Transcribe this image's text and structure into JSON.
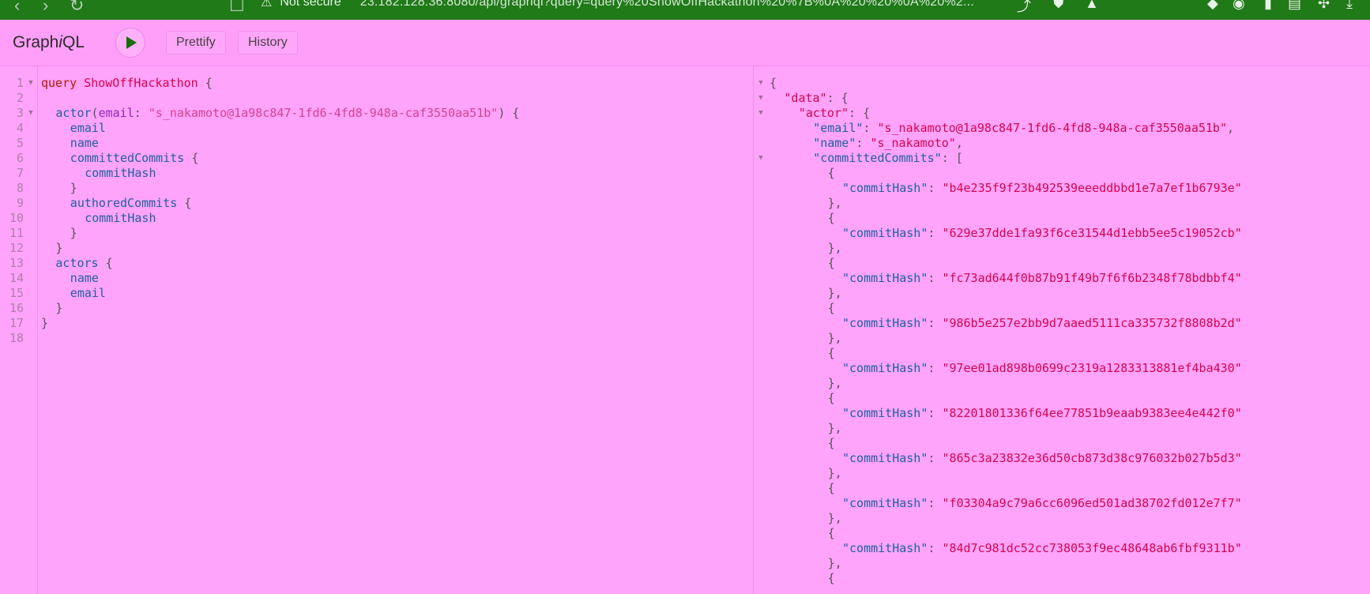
{
  "browser": {
    "security_label": "Not secure",
    "url": "23.182.128.36:8080/api/graphql?query=query%20ShowOffHackathon%20%7B%0A%20%20%0A%20%2..."
  },
  "toolbar": {
    "logo_part1": "Graph",
    "logo_part2": "i",
    "logo_part3": "QL",
    "prettify_label": "Prettify",
    "history_label": "History"
  },
  "query_lines": [
    {
      "n": "1",
      "fold": true,
      "indent": 0,
      "tokens": [
        [
          "kw",
          "query "
        ],
        [
          "def",
          "ShowOffHackathon"
        ],
        [
          "pun",
          " {"
        ]
      ]
    },
    {
      "n": "2",
      "fold": false,
      "indent": 0,
      "tokens": []
    },
    {
      "n": "3",
      "fold": true,
      "indent": 1,
      "tokens": [
        [
          "prop",
          "actor"
        ],
        [
          "pun",
          "("
        ],
        [
          "attr",
          "email"
        ],
        [
          "pun",
          ": "
        ],
        [
          "str",
          "\"s_nakamoto@1a98c847-1fd6-4fd8-948a-caf3550aa51b\""
        ],
        [
          "pun",
          ") {"
        ]
      ]
    },
    {
      "n": "4",
      "fold": false,
      "indent": 2,
      "tokens": [
        [
          "prop",
          "email"
        ]
      ]
    },
    {
      "n": "5",
      "fold": false,
      "indent": 2,
      "tokens": [
        [
          "prop",
          "name"
        ]
      ]
    },
    {
      "n": "6",
      "fold": false,
      "indent": 2,
      "tokens": [
        [
          "prop",
          "committedCommits"
        ],
        [
          "pun",
          " {"
        ]
      ]
    },
    {
      "n": "7",
      "fold": false,
      "indent": 3,
      "tokens": [
        [
          "prop",
          "commitHash"
        ]
      ]
    },
    {
      "n": "8",
      "fold": false,
      "indent": 2,
      "tokens": [
        [
          "pun",
          "}"
        ]
      ]
    },
    {
      "n": "9",
      "fold": false,
      "indent": 2,
      "tokens": [
        [
          "prop",
          "authoredCommits"
        ],
        [
          "pun",
          " {"
        ]
      ]
    },
    {
      "n": "10",
      "fold": false,
      "indent": 3,
      "tokens": [
        [
          "prop",
          "commitHash"
        ]
      ]
    },
    {
      "n": "11",
      "fold": false,
      "indent": 2,
      "tokens": [
        [
          "pun",
          "}"
        ]
      ]
    },
    {
      "n": "12",
      "fold": false,
      "indent": 1,
      "tokens": [
        [
          "pun",
          "}"
        ]
      ]
    },
    {
      "n": "13",
      "fold": false,
      "indent": 1,
      "tokens": [
        [
          "prop",
          "actors"
        ],
        [
          "pun",
          " {"
        ]
      ]
    },
    {
      "n": "14",
      "fold": false,
      "indent": 2,
      "tokens": [
        [
          "prop",
          "name"
        ]
      ]
    },
    {
      "n": "15",
      "fold": false,
      "indent": 2,
      "tokens": [
        [
          "prop",
          "email"
        ]
      ]
    },
    {
      "n": "16",
      "fold": false,
      "indent": 1,
      "tokens": [
        [
          "pun",
          "}"
        ]
      ]
    },
    {
      "n": "17",
      "fold": false,
      "indent": 0,
      "tokens": [
        [
          "pun",
          "}"
        ]
      ]
    },
    {
      "n": "18",
      "fold": false,
      "indent": 0,
      "tokens": []
    }
  ],
  "result_lines": [
    {
      "fold": true,
      "indent": 0,
      "tokens": [
        [
          "pun",
          "{"
        ]
      ]
    },
    {
      "fold": true,
      "indent": 1,
      "tokens": [
        [
          "jstr",
          "\"data\""
        ],
        [
          "pun",
          ": {"
        ]
      ]
    },
    {
      "fold": true,
      "indent": 2,
      "tokens": [
        [
          "jstr",
          "\"actor\""
        ],
        [
          "pun",
          ": {"
        ]
      ]
    },
    {
      "fold": false,
      "indent": 3,
      "tokens": [
        [
          "jkey",
          "\"email\""
        ],
        [
          "pun",
          ": "
        ],
        [
          "jstr",
          "\"s_nakamoto@1a98c847-1fd6-4fd8-948a-caf3550aa51b\""
        ],
        [
          "pun",
          ","
        ]
      ]
    },
    {
      "fold": false,
      "indent": 3,
      "tokens": [
        [
          "jkey",
          "\"name\""
        ],
        [
          "pun",
          ": "
        ],
        [
          "jstr",
          "\"s_nakamoto\""
        ],
        [
          "pun",
          ","
        ]
      ]
    },
    {
      "fold": true,
      "indent": 3,
      "tokens": [
        [
          "jkey",
          "\"committedCommits\""
        ],
        [
          "pun",
          ": ["
        ]
      ]
    },
    {
      "fold": false,
      "indent": 4,
      "tokens": [
        [
          "pun",
          "{"
        ]
      ]
    },
    {
      "fold": false,
      "indent": 5,
      "tokens": [
        [
          "jkey",
          "\"commitHash\""
        ],
        [
          "pun",
          ": "
        ],
        [
          "jstr",
          "\"b4e235f9f23b492539eeeddbbd1e7a7ef1b6793e\""
        ]
      ]
    },
    {
      "fold": false,
      "indent": 4,
      "tokens": [
        [
          "pun",
          "},"
        ]
      ]
    },
    {
      "fold": false,
      "indent": 4,
      "tokens": [
        [
          "pun",
          "{"
        ]
      ]
    },
    {
      "fold": false,
      "indent": 5,
      "tokens": [
        [
          "jkey",
          "\"commitHash\""
        ],
        [
          "pun",
          ": "
        ],
        [
          "jstr",
          "\"629e37dde1fa93f6ce31544d1ebb5ee5c19052cb\""
        ]
      ]
    },
    {
      "fold": false,
      "indent": 4,
      "tokens": [
        [
          "pun",
          "},"
        ]
      ]
    },
    {
      "fold": false,
      "indent": 4,
      "tokens": [
        [
          "pun",
          "{"
        ]
      ]
    },
    {
      "fold": false,
      "indent": 5,
      "tokens": [
        [
          "jkey",
          "\"commitHash\""
        ],
        [
          "pun",
          ": "
        ],
        [
          "jstr",
          "\"fc73ad644f0b87b91f49b7f6f6b2348f78bdbbf4\""
        ]
      ]
    },
    {
      "fold": false,
      "indent": 4,
      "tokens": [
        [
          "pun",
          "},"
        ]
      ]
    },
    {
      "fold": false,
      "indent": 4,
      "tokens": [
        [
          "pun",
          "{"
        ]
      ]
    },
    {
      "fold": false,
      "indent": 5,
      "tokens": [
        [
          "jkey",
          "\"commitHash\""
        ],
        [
          "pun",
          ": "
        ],
        [
          "jstr",
          "\"986b5e257e2bb9d7aaed5111ca335732f8808b2d\""
        ]
      ]
    },
    {
      "fold": false,
      "indent": 4,
      "tokens": [
        [
          "pun",
          "},"
        ]
      ]
    },
    {
      "fold": false,
      "indent": 4,
      "tokens": [
        [
          "pun",
          "{"
        ]
      ]
    },
    {
      "fold": false,
      "indent": 5,
      "tokens": [
        [
          "jkey",
          "\"commitHash\""
        ],
        [
          "pun",
          ": "
        ],
        [
          "jstr",
          "\"97ee01ad898b0699c2319a1283313881ef4ba430\""
        ]
      ]
    },
    {
      "fold": false,
      "indent": 4,
      "tokens": [
        [
          "pun",
          "},"
        ]
      ]
    },
    {
      "fold": false,
      "indent": 4,
      "tokens": [
        [
          "pun",
          "{"
        ]
      ]
    },
    {
      "fold": false,
      "indent": 5,
      "tokens": [
        [
          "jkey",
          "\"commitHash\""
        ],
        [
          "pun",
          ": "
        ],
        [
          "jstr",
          "\"82201801336f64ee77851b9eaab9383ee4e442f0\""
        ]
      ]
    },
    {
      "fold": false,
      "indent": 4,
      "tokens": [
        [
          "pun",
          "},"
        ]
      ]
    },
    {
      "fold": false,
      "indent": 4,
      "tokens": [
        [
          "pun",
          "{"
        ]
      ]
    },
    {
      "fold": false,
      "indent": 5,
      "tokens": [
        [
          "jkey",
          "\"commitHash\""
        ],
        [
          "pun",
          ": "
        ],
        [
          "jstr",
          "\"865c3a23832e36d50cb873d38c976032b027b5d3\""
        ]
      ]
    },
    {
      "fold": false,
      "indent": 4,
      "tokens": [
        [
          "pun",
          "},"
        ]
      ]
    },
    {
      "fold": false,
      "indent": 4,
      "tokens": [
        [
          "pun",
          "{"
        ]
      ]
    },
    {
      "fold": false,
      "indent": 5,
      "tokens": [
        [
          "jkey",
          "\"commitHash\""
        ],
        [
          "pun",
          ": "
        ],
        [
          "jstr",
          "\"f03304a9c79a6cc6096ed501ad38702fd012e7f7\""
        ]
      ]
    },
    {
      "fold": false,
      "indent": 4,
      "tokens": [
        [
          "pun",
          "},"
        ]
      ]
    },
    {
      "fold": false,
      "indent": 4,
      "tokens": [
        [
          "pun",
          "{"
        ]
      ]
    },
    {
      "fold": false,
      "indent": 5,
      "tokens": [
        [
          "jkey",
          "\"commitHash\""
        ],
        [
          "pun",
          ": "
        ],
        [
          "jstr",
          "\"84d7c981dc52cc738053f9ec48648ab6fbf9311b\""
        ]
      ]
    },
    {
      "fold": false,
      "indent": 4,
      "tokens": [
        [
          "pun",
          "},"
        ]
      ]
    },
    {
      "fold": false,
      "indent": 4,
      "tokens": [
        [
          "pun",
          "{"
        ]
      ]
    }
  ],
  "colors": {
    "background": "#ffa3fb",
    "browser_bar": "#1f7a17",
    "run_icon": "#1a6d10",
    "keyword": "#b11a04",
    "def": "#d2054e",
    "property": "#1f61a0",
    "attribute": "#8b2bb9",
    "string": "#d64292"
  }
}
